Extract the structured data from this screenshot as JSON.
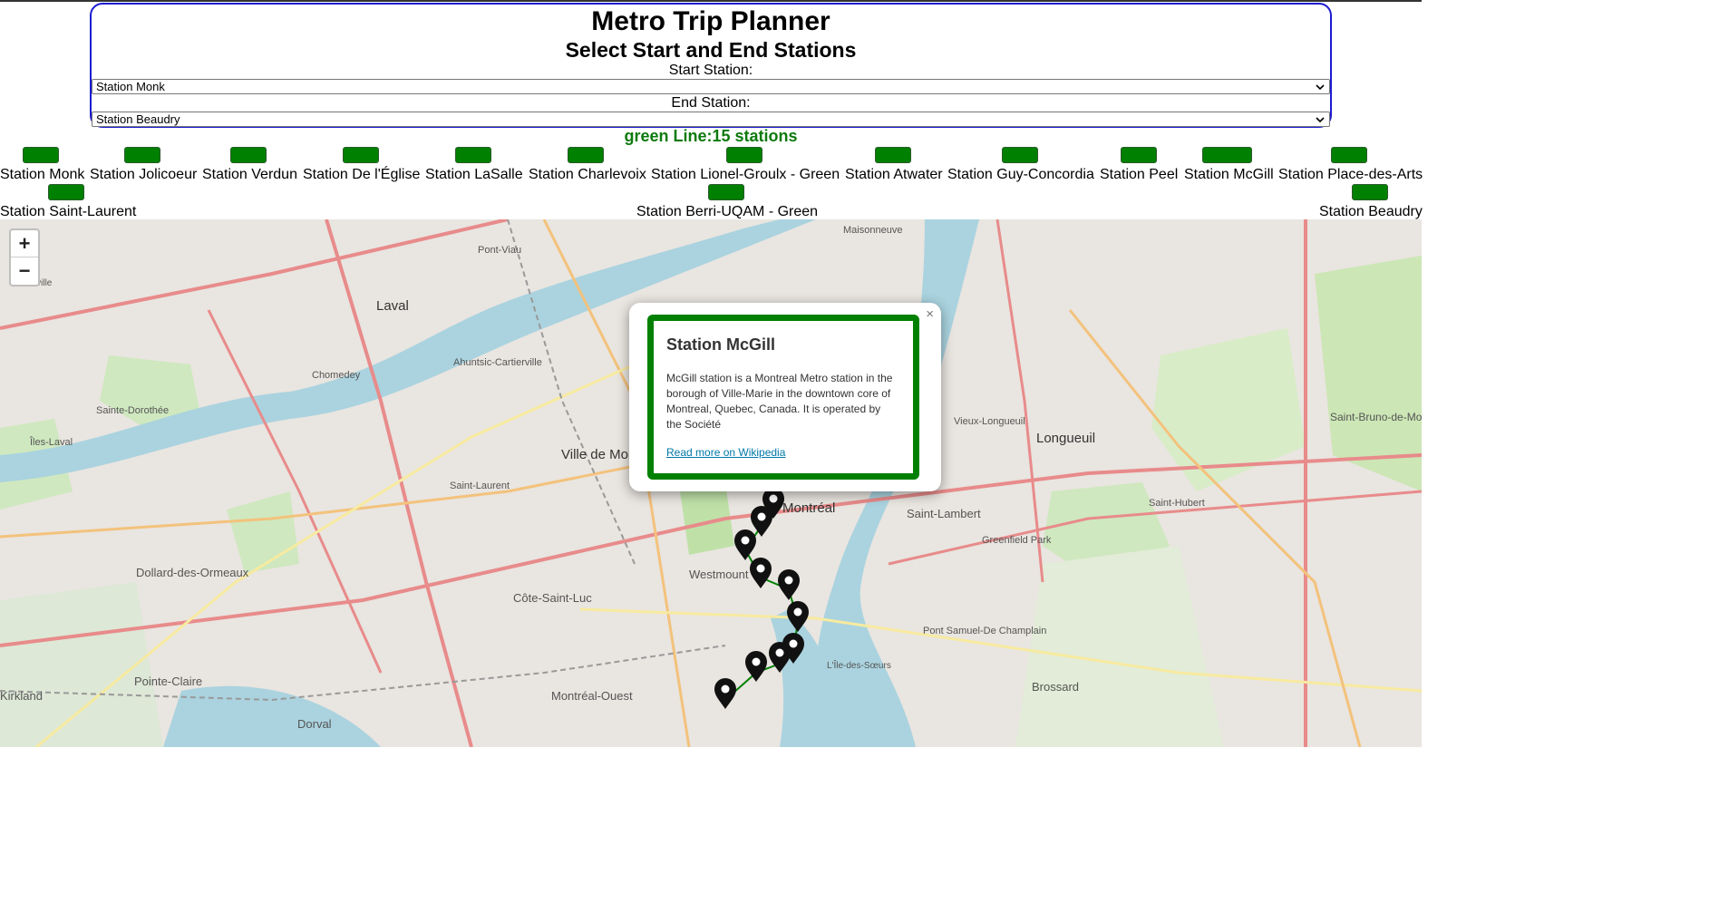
{
  "header": {
    "title": "Metro Trip Planner",
    "subtitle": "Select Start and End Stations",
    "start_label": "Start Station:",
    "start_value": "Station Monk",
    "end_label": "End Station:",
    "end_value": "Station Beaudry"
  },
  "line_summary": "green Line:15 stations",
  "accent_color": "#008000",
  "stations": [
    "Station Monk",
    "Station Jolicoeur",
    "Station Verdun",
    "Station De l'Église",
    "Station LaSalle",
    "Station Charlevoix",
    "Station Lionel-Groulx - Green",
    "Station Atwater",
    "Station Guy-Concordia",
    "Station Peel",
    "Station McGill",
    "Station Place-des-Arts",
    "Station Saint-Laurent",
    "Station Berri-UQAM - Green",
    "Station Beaudry"
  ],
  "map": {
    "zoom_in": "+",
    "zoom_out": "−",
    "labels": [
      "Laval",
      "Pont-Viau",
      "Chomedey",
      "Sainte-Dorothée",
      "Îles-Laval",
      "Ahuntsic-Cartierville",
      "Saint-Laurent",
      "Ville de Mont-Royal",
      "Montréal",
      "Westmount",
      "Côte-Saint-Luc",
      "Dollard-des-Ormeaux",
      "Pointe-Claire",
      "Kirkland",
      "Dorval",
      "Montréal-Ouest",
      "Longueuil",
      "Vieux-Longueuil",
      "Saint-Lambert",
      "Greenfield Park",
      "Saint-Hubert",
      "Brossard",
      "Saint-Bruno-de-Montarville",
      "Maisonneuve",
      "Pont Samuel-De Champlain",
      "L'Île-des-Sœurs",
      "Fabreville"
    ],
    "popup": {
      "title": "Station McGill",
      "description": "McGill station is a Montreal Metro station in the borough of Ville-Marie in the downtown core of Montreal, Quebec, Canada. It is operated by the Société",
      "link_text": "Read more on Wikipedia",
      "close": "×"
    }
  }
}
